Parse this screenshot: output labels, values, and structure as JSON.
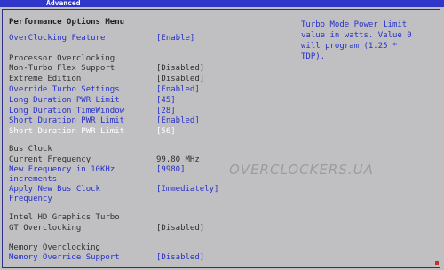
{
  "header": {
    "tab": "Advanced"
  },
  "menu": {
    "title": "Performance Options Menu"
  },
  "help_text": "Turbo Mode Power Limit\nvalue in watts. Value 0\nwill program (1.25 *\nTDP).",
  "rows": [
    {
      "label": "OverClocking Feature",
      "value": "[Enable]",
      "style": "blue"
    },
    {
      "label": "Processor Overclocking",
      "value": "",
      "style": "gray"
    },
    {
      "label": "Non-Turbo Flex Support",
      "value": "[Disabled]",
      "style": "gray"
    },
    {
      "label": "Extreme Edition",
      "value": "[Disabled]",
      "style": "gray"
    },
    {
      "label": "Override Turbo Settings",
      "value": "[Enabled]",
      "style": "blue"
    },
    {
      "label": "Long Duration PWR Limit",
      "value": "[45]",
      "style": "blue"
    },
    {
      "label": "Long Duration TimeWindow",
      "value": "[28]",
      "style": "blue"
    },
    {
      "label": "Short Duration PWR Limit",
      "value": "[Enabled]",
      "style": "blue"
    },
    {
      "label": "Short Duration PWR Limit",
      "value": "[56]",
      "style": "white"
    },
    {
      "label": "Bus Clock",
      "value": "",
      "style": "gray"
    },
    {
      "label": "Current Frequency",
      "value": "99.80 MHz",
      "style": "gray"
    },
    {
      "label": "New Frequency in 10KHz",
      "value": "[9980]",
      "style": "blue"
    },
    {
      "label": "increments",
      "value": "",
      "style": "blue"
    },
    {
      "label": "Apply New Bus Clock",
      "value": "[Immediately]",
      "style": "blue"
    },
    {
      "label": "Frequency",
      "value": "",
      "style": "blue"
    },
    {
      "label": "Intel HD Graphics Turbo",
      "value": "",
      "style": "gray"
    },
    {
      "label": "GT Overclocking",
      "value": "[Disabled]",
      "style": "gray"
    },
    {
      "label": "Memory Overclocking",
      "value": "",
      "style": "gray"
    },
    {
      "label": "Memory Override Support",
      "value": "[Disabled]",
      "style": "blue"
    }
  ],
  "watermark": "OVERCLOCKERS.UA"
}
